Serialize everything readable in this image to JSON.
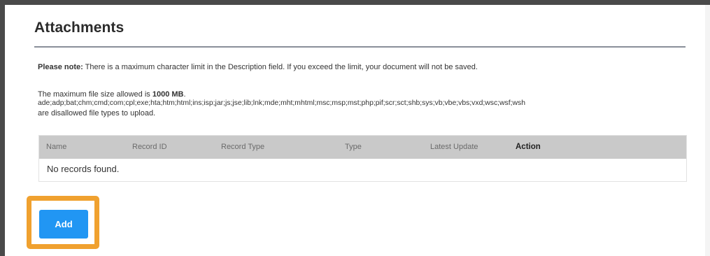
{
  "section": {
    "title": "Attachments"
  },
  "note": {
    "label": "Please note:",
    "text": " There is a maximum character limit in the Description field. If you exceed the limit, your document will not be saved."
  },
  "limits": {
    "max_size_prefix": "The maximum file size allowed is ",
    "max_size_value": "1000 MB",
    "max_size_suffix": ".",
    "file_types": "ade;adp;bat;chm;cmd;com;cpl;exe;hta;htm;html;ins;isp;jar;js;jse;lib;lnk;mde;mht;mhtml;msc;msp;mst;php;pif;scr;sct;shb;sys;vb;vbe;vbs;vxd;wsc;wsf;wsh",
    "disallowed_text": "are disallowed file types to upload."
  },
  "table": {
    "columns": [
      "Name",
      "Record ID",
      "Record Type",
      "Type",
      "Latest Update",
      "Action"
    ],
    "empty_message": "No records found."
  },
  "actions": {
    "add_label": "Add",
    "highlight_color": "#f0a12f",
    "button_color": "#2196f3"
  }
}
